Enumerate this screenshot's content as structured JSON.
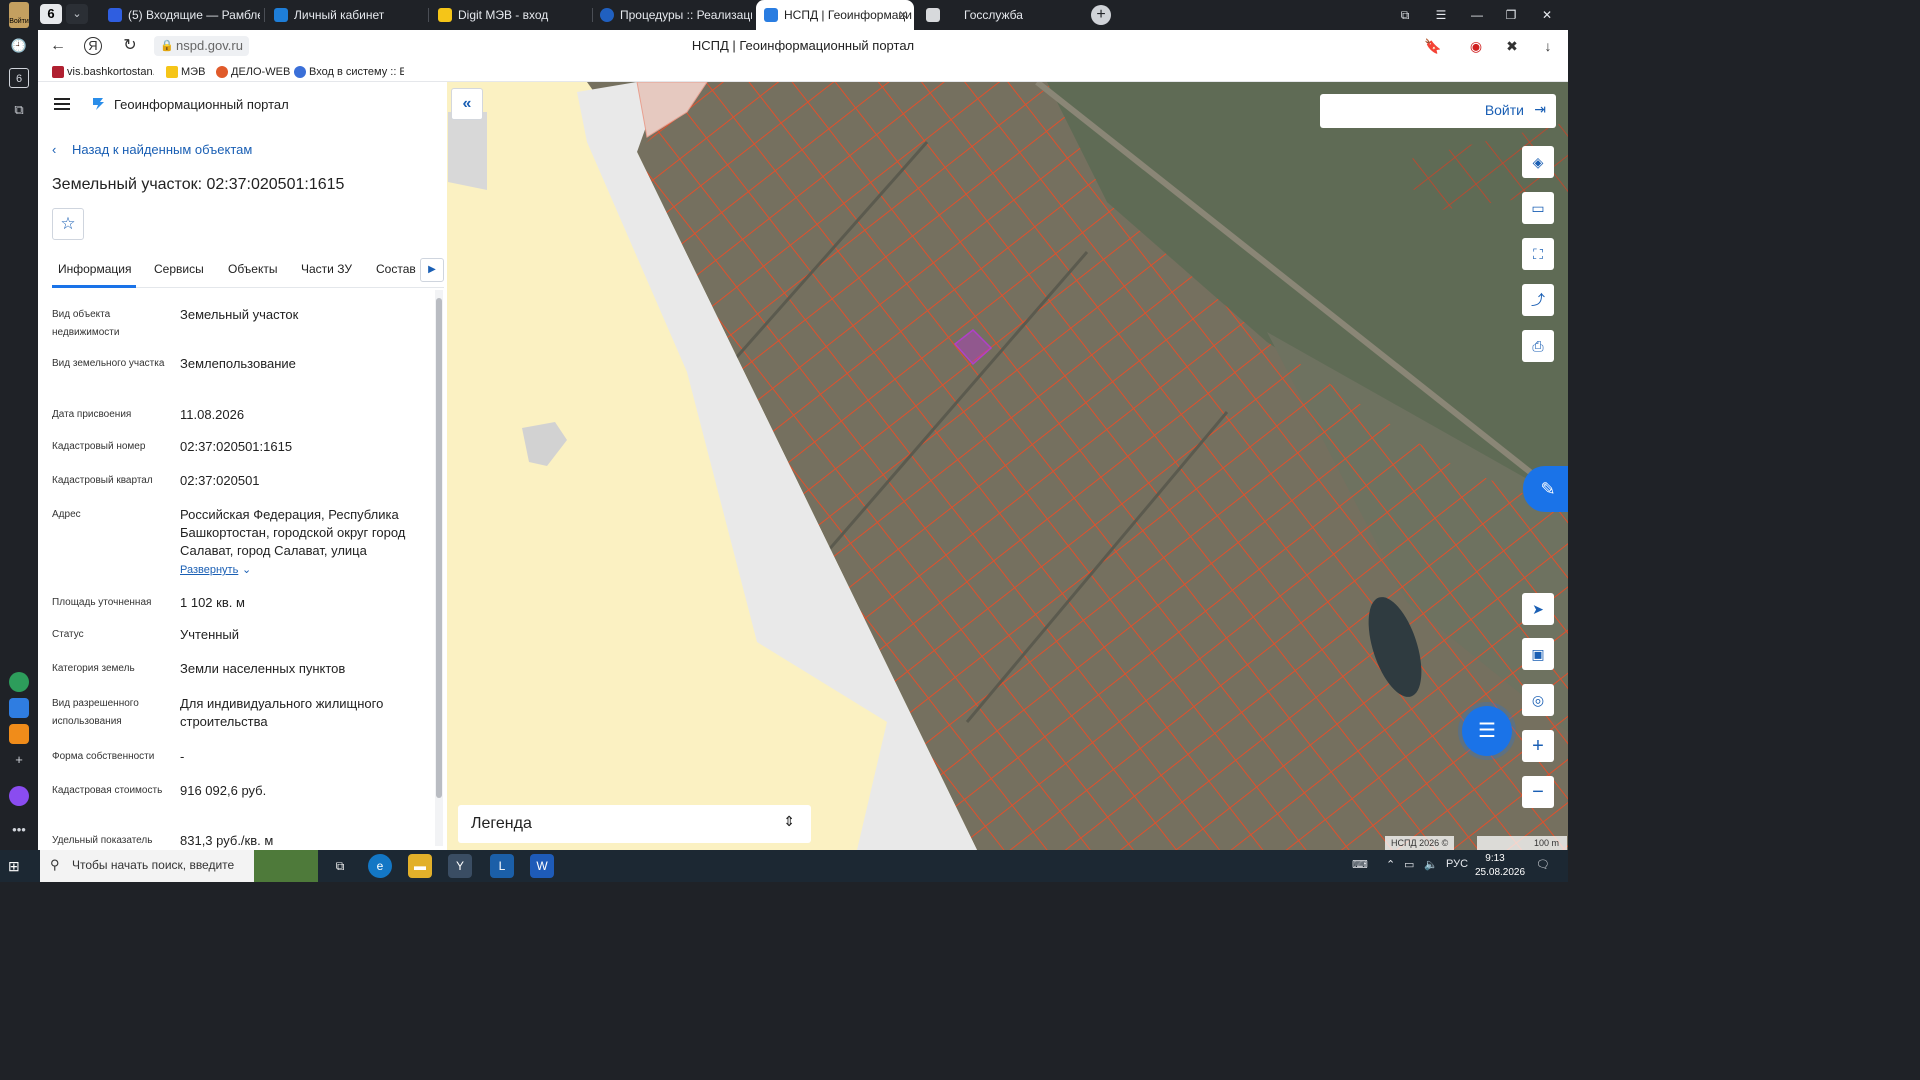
{
  "browser": {
    "tab_count": "6",
    "tabs": [
      {
        "label": "(5) Входящие — Рамблер/",
        "active": false
      },
      {
        "label": "Личный кабинет",
        "active": false
      },
      {
        "label": "Digit МЭВ - вход",
        "active": false
      },
      {
        "label": "Процедуры :: Реализация",
        "active": false
      },
      {
        "label": "НСПД | Геоинформаци",
        "active": true
      },
      {
        "label": "Госслужба",
        "active": false
      }
    ],
    "url": "nspd.gov.ru",
    "page_title": "НСПД | Геоинформационный портал",
    "side_login_label": "Войти",
    "bookmarks": [
      {
        "label": "vis.bashkortostan.r"
      },
      {
        "label": "МЭВ"
      },
      {
        "label": "ДЕЛО-WEB"
      },
      {
        "label": "Вход в систему :: Е"
      }
    ]
  },
  "panel": {
    "portal_title": "Геоинформационный портал",
    "back_link": "Назад к найденным объектам",
    "heading": "Земельный участок: 02:37:020501:1615",
    "tabs": [
      "Информация",
      "Сервисы",
      "Объекты",
      "Части ЗУ",
      "Состав"
    ],
    "fields": [
      {
        "label": "Вид объекта недвижимости",
        "value": "Земельный участок"
      },
      {
        "label": "Вид земельного участка",
        "value": "Землепользование"
      },
      {
        "label": "Дата присвоения",
        "value": "11.08.2026"
      },
      {
        "label": "Кадастровый номер",
        "value": "02:37:020501:1615"
      },
      {
        "label": "Кадастровый квартал",
        "value": "02:37:020501"
      },
      {
        "label": "Адрес",
        "value": "Российская Федерация, Республика Башкортостан, городской округ город Салават, город Салават, улица",
        "expand": "Развернуть"
      },
      {
        "label": "Площадь уточненная",
        "value": "1 102 кв. м"
      },
      {
        "label": "Статус",
        "value": "Учтенный"
      },
      {
        "label": "Категория земель",
        "value": "Земли населенных пунктов"
      },
      {
        "label": "Вид разрешенного использования",
        "value": "Для индивидуального жилищного строительства"
      },
      {
        "label": "Форма собственности",
        "value": "-"
      },
      {
        "label": "Кадастровая стоимость",
        "value": "916 092,6 руб."
      },
      {
        "label": "Удельный показатель",
        "value": "831,3 руб./кв. м"
      }
    ]
  },
  "map": {
    "login_label": "Войти",
    "legend_label": "Легенда",
    "attribution": "НСПД 2026 ©",
    "scale_label": "100 m"
  },
  "taskbar": {
    "search_placeholder": "Чтобы начать поиск, введите",
    "lang": "РУС",
    "time": "9:13",
    "date": "25.08.2026"
  }
}
